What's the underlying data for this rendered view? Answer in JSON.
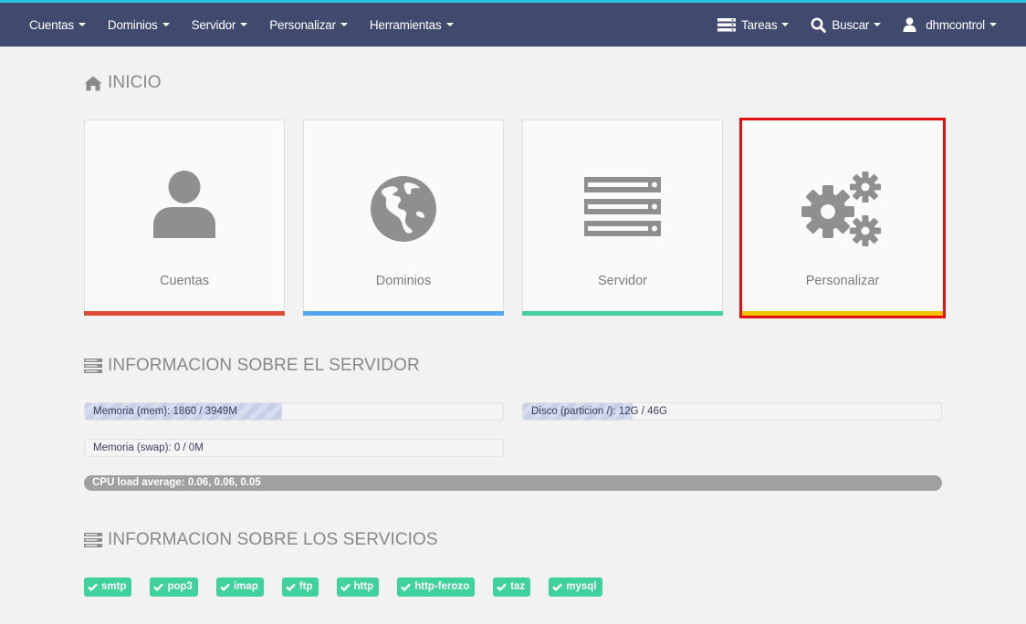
{
  "nav": {
    "left": [
      {
        "label": "Cuentas"
      },
      {
        "label": "Dominios"
      },
      {
        "label": "Servidor"
      },
      {
        "label": "Personalizar"
      },
      {
        "label": "Herramientas"
      }
    ],
    "tasks_label": "Tareas",
    "search_label": "Buscar",
    "user_label": "dhmcontrol"
  },
  "home_title": "INICIO",
  "tiles": [
    {
      "label": "Cuentas",
      "icon": "user-icon",
      "bar_color": "#dd4b39"
    },
    {
      "label": "Dominios",
      "icon": "globe-icon",
      "bar_color": "#52a7f0"
    },
    {
      "label": "Servidor",
      "icon": "server-icon",
      "bar_color": "#48d1a0"
    },
    {
      "label": "Personalizar",
      "icon": "gears-icon",
      "bar_color": "#f5c400"
    }
  ],
  "server_info": {
    "title": "INFORMACION SOBRE EL SERVIDOR",
    "memory": {
      "label": "Memoria (mem): 1860 / 3949M",
      "fraction": 0.471
    },
    "disk": {
      "label": "Disco (particion /): 12G / 46G",
      "fraction": 0.261
    },
    "swap": {
      "label": "Memoria (swap): 0 / 0M",
      "fraction": 0
    },
    "cpu": {
      "label": "CPU load average: 0.06, 0.06, 0.05"
    }
  },
  "services_info": {
    "title": "INFORMACION SOBRE LOS SERVICIOS",
    "items": [
      {
        "label": "smtp"
      },
      {
        "label": "pop3"
      },
      {
        "label": "imap"
      },
      {
        "label": "ftp"
      },
      {
        "label": "http"
      },
      {
        "label": "http-ferozo"
      },
      {
        "label": "taz"
      },
      {
        "label": "mysql"
      }
    ]
  },
  "colors": {
    "topbar": "#404a6e",
    "accent": "#25c5e0",
    "selected_border": "#e01010",
    "service_ok": "#3fd29c"
  }
}
